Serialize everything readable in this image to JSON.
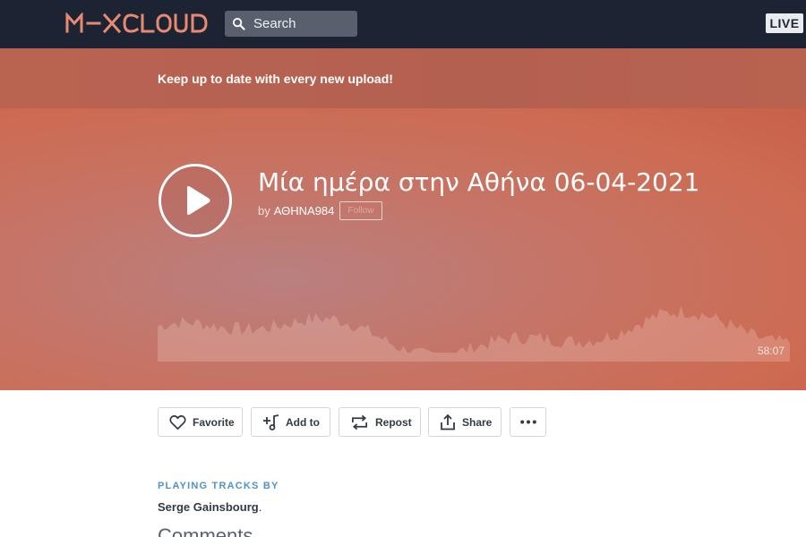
{
  "header": {
    "logo_text": "M–XCLOUD",
    "search_placeholder": "Search",
    "live_label": "LIVE"
  },
  "banner": {
    "text": "Keep up to date with every new upload!"
  },
  "show": {
    "title": "Μία ημέρα στην Αθήνα 06-04-2021",
    "by_prefix": "by",
    "author": "ΑΘΗΝΑ984",
    "follow_label": "Follow",
    "duration": "58:07"
  },
  "actions": {
    "favorite": "Favorite",
    "add_to": "Add to",
    "repost": "Repost",
    "share": "Share"
  },
  "tracks": {
    "label": "PLAYING TRACKS BY",
    "artist": "Serge Gainsbourg",
    "suffix": "."
  },
  "comments": {
    "heading": "Comments"
  },
  "colors": {
    "nav_bg": "#1c2433",
    "hero": "#cd6b53",
    "accent_blue": "#4f93c7"
  }
}
